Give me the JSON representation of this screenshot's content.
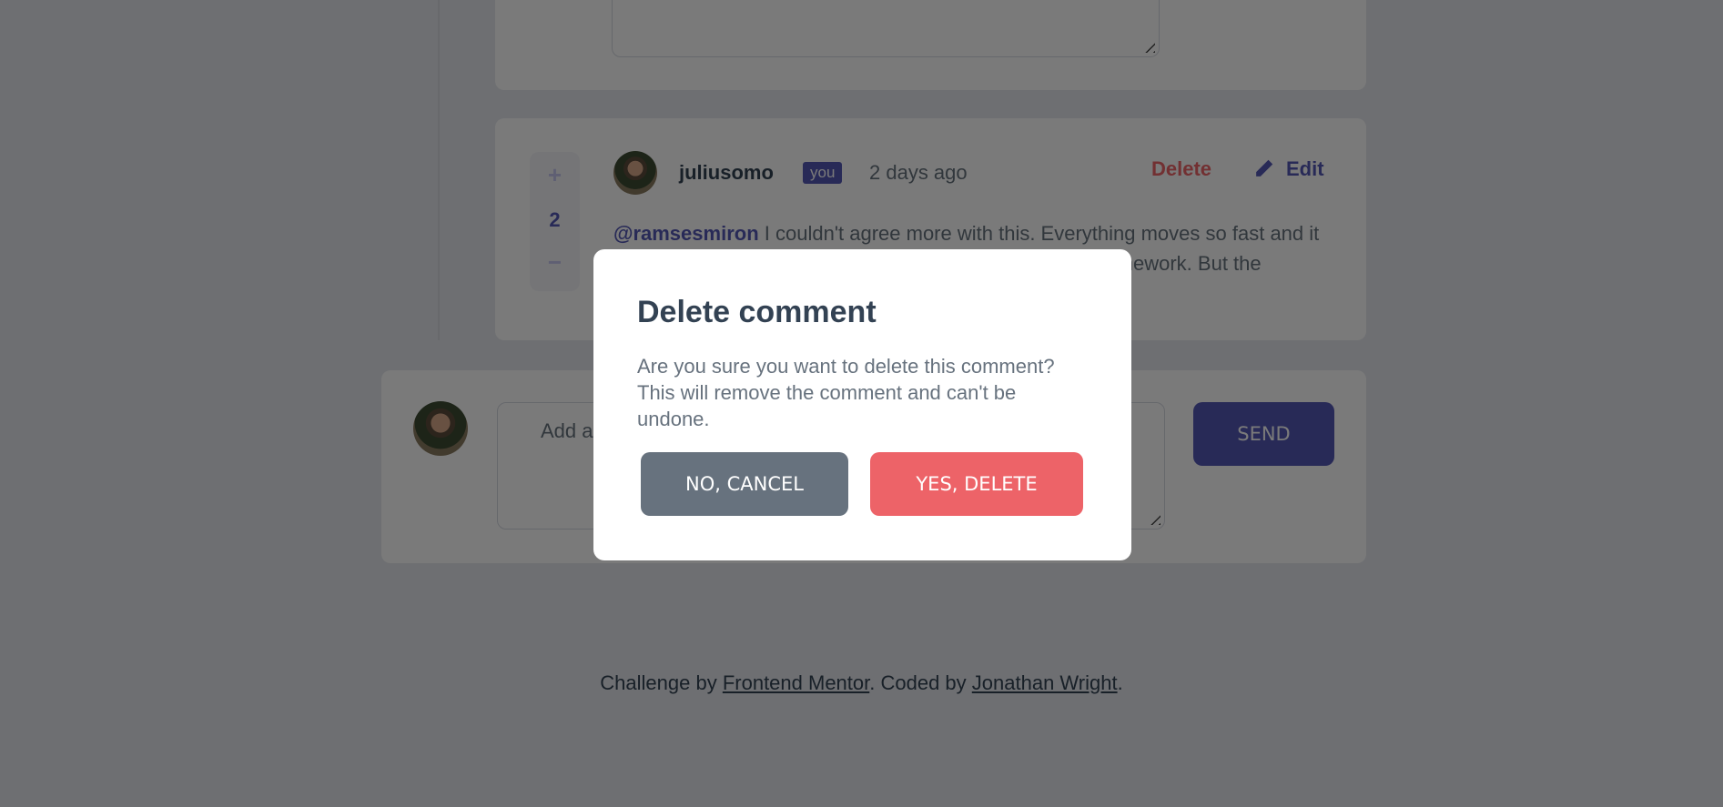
{
  "reply_form_top": {
    "placeholder": ""
  },
  "comment": {
    "score": "2",
    "upvote_icon": "plus-icon",
    "downvote_icon": "minus-icon",
    "username": "juliusomo",
    "you_badge": "you",
    "time": "2 days ago",
    "delete_label": "Delete",
    "edit_label": "Edit",
    "edit_icon": "pencil-icon",
    "mention": "@ramsesmiron",
    "content": "I couldn't agree more with this. Everything moves so fast and it always seems like everyone knows the newest library/framework. But the fundamentals are what stay constant."
  },
  "add_comment": {
    "placeholder": "Add a comment...",
    "send_label": "SEND"
  },
  "modal": {
    "title": "Delete comment",
    "message": "Are you sure you want to delete this comment? This will remove the comment and can't be undone.",
    "cancel_label": "NO, CANCEL",
    "confirm_label": "YES, DELETE"
  },
  "footer": {
    "prefix": "Challenge by ",
    "link1": "Frontend Mentor",
    "middle": ". Coded by ",
    "link2": "Jonathan Wright",
    "suffix": "."
  },
  "colors": {
    "primary": "#5357b6",
    "danger": "#ed6368",
    "neutral": "#67727e",
    "dark": "#334253"
  }
}
